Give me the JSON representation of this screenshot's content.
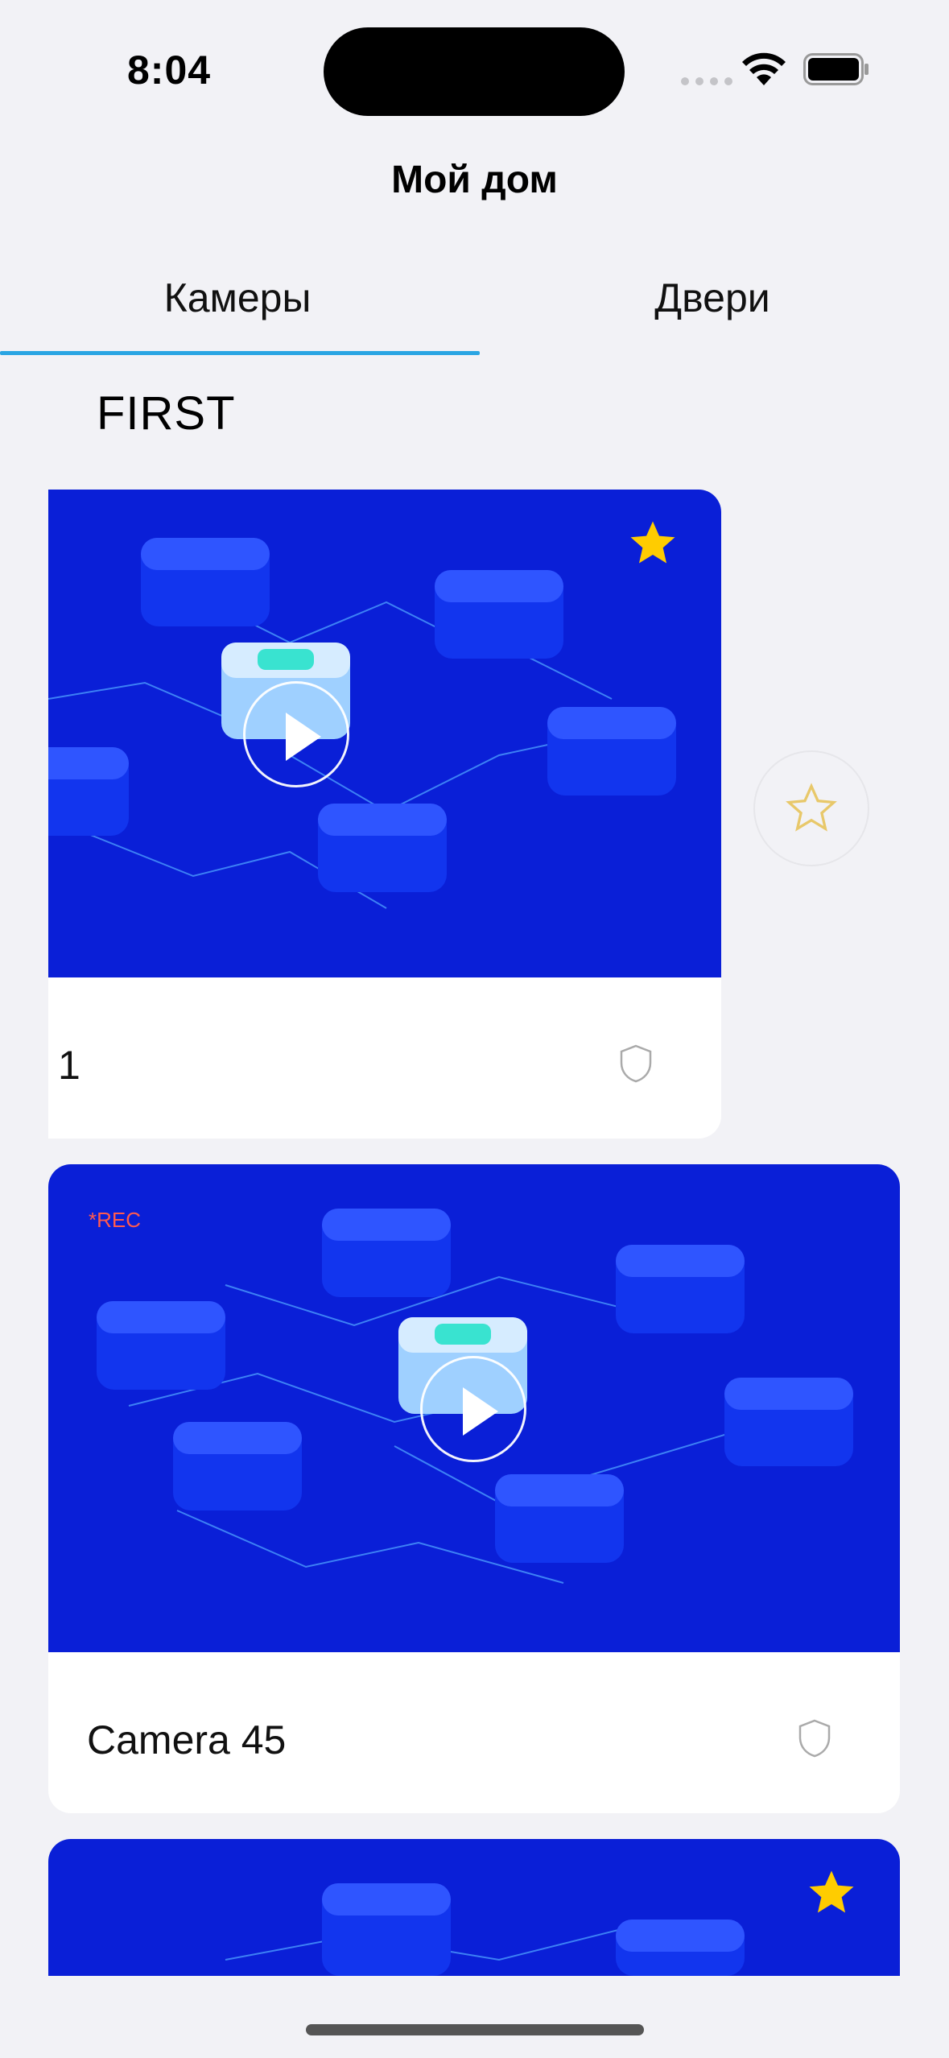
{
  "status_bar": {
    "time": "8:04"
  },
  "header": {
    "title": "Мой дом"
  },
  "tabs": [
    {
      "label": "Камеры",
      "active": true
    },
    {
      "label": "Двери",
      "active": false
    }
  ],
  "section": {
    "title": "FIRST"
  },
  "cameras": [
    {
      "name": "1",
      "favorite": true,
      "recording": false
    },
    {
      "name": "Camera 45",
      "favorite": false,
      "recording": true,
      "rec_label": "*REC"
    },
    {
      "name": "",
      "favorite": true,
      "recording": false
    }
  ],
  "colors": {
    "accent": "#2aa5e3",
    "preview_bg": "#0a1fd7",
    "star": "#ffcc00",
    "rec": "#ff5a4e"
  },
  "icons": [
    "wifi-icon",
    "battery-icon",
    "star-icon",
    "star-outline-icon",
    "shield-icon",
    "play-icon"
  ]
}
